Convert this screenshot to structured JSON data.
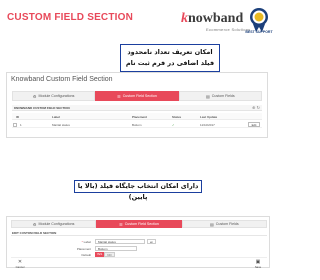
{
  "header": {
    "title": "CUSTOM FIELD SECTION",
    "logo_main": "nowband",
    "logo_k": "k",
    "logo_tagline": "Ecommerce Solutions",
    "badge_text": "BEST SUPPORT"
  },
  "callouts": {
    "first": "امکان تعریف تعداد نامحدود فیلد اضافی در فرم ثبت نام",
    "second": "دارای امکان انتخاب جایگاه فیلد (بالا یا پایین)"
  },
  "panel1": {
    "title": "Knowband Custom Field Section",
    "tabs": [
      {
        "label": "Module Configurations",
        "icon": "gear-icon"
      },
      {
        "label": "Custom Field Section",
        "icon": "list-icon"
      },
      {
        "label": "Custom Fields",
        "icon": "field-icon"
      }
    ],
    "section_label": "KNOWBAND CUSTOM FIELD SECTION",
    "section_count": "1",
    "columns": [
      "ID",
      "Label",
      "Placement",
      "Status",
      "Last Update"
    ],
    "rows": [
      {
        "id": "1",
        "label": "Marital status",
        "placement": "Bottom",
        "status": "✓",
        "updated": "11/10/2017",
        "action": "Edit"
      }
    ]
  },
  "panel2": {
    "tabs": [
      {
        "label": "Module Configurations"
      },
      {
        "label": "Custom Field Section"
      },
      {
        "label": "Custom Fields"
      }
    ],
    "section_label": "EDIT CUSTOM FIELD SECTION",
    "fields": {
      "label_label": "Label",
      "label_value": "Marital status",
      "lang": "en",
      "placement_label": "Placement",
      "placement_value": "Bottom",
      "default_label": "Default",
      "yes": "YES",
      "no": "NO"
    },
    "footer": {
      "cancel": "Cancel",
      "save": "Save"
    }
  },
  "colors": {
    "accent": "#e8495a",
    "callout_border": "#1b3f9e"
  }
}
